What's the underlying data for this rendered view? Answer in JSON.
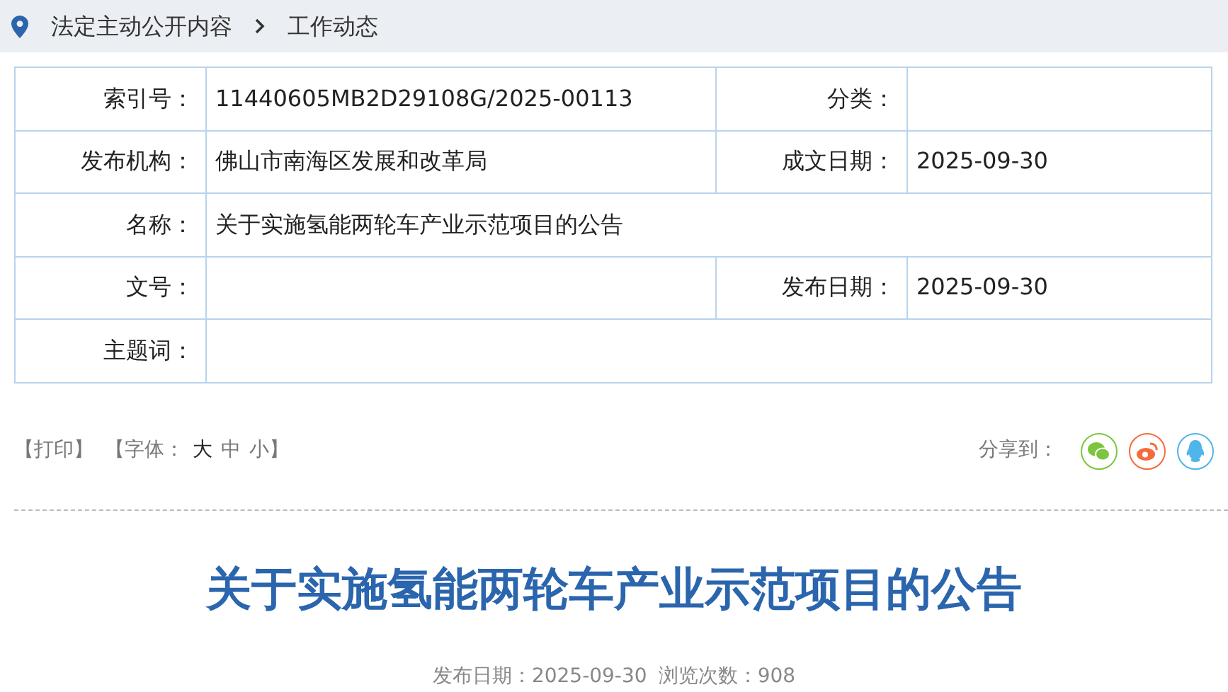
{
  "breadcrumb": {
    "items": [
      "法定主动公开内容",
      "工作动态"
    ]
  },
  "info_table": {
    "rows": [
      {
        "cells": [
          {
            "label": "索引号：",
            "value": "11440605MB2D29108G/2025-00113"
          },
          {
            "label": "分类："
          }
        ]
      },
      {
        "cells": [
          {
            "label": "发布机构：",
            "value": "佛山市南海区发展和改革局"
          },
          {
            "label": "成文日期：",
            "value": "2025-09-30"
          }
        ]
      },
      {
        "cells": [
          {
            "label": "名称：",
            "value": "关于实施氢能两轮车产业示范项目的公告"
          }
        ]
      },
      {
        "cells": [
          {
            "label": "文号："
          },
          {
            "label": "发布日期：",
            "value": "2025-09-30"
          }
        ]
      },
      {
        "cells": [
          {
            "label": "主题词："
          }
        ]
      }
    ]
  },
  "toolbar": {
    "print": "【打印】",
    "font_label": "【字体：",
    "font_sizes": [
      {
        "label": "大",
        "selected": true
      },
      {
        "label": "中",
        "selected": false
      },
      {
        "label": "小",
        "selected": false
      }
    ],
    "font_close": "】",
    "share_label": "分享到：",
    "share": [
      {
        "kind": "wechat",
        "color": "#7cc53e"
      },
      {
        "kind": "weibo",
        "color": "#f56b3a"
      },
      {
        "kind": "qq",
        "color": "#4fb5ea"
      }
    ]
  },
  "article": {
    "title": "关于实施氢能两轮车产业示范项目的公告",
    "date": "发布日期：2025-09-30",
    "views": "浏览次数：908"
  }
}
